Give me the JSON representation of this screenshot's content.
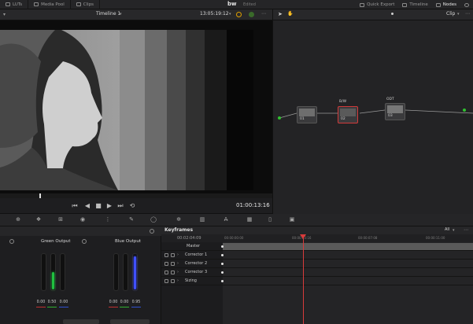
{
  "topbar": {
    "items": [
      {
        "label": "LUTs",
        "icon": "luts-icon"
      },
      {
        "label": "Media Pool",
        "icon": "media-pool-icon"
      },
      {
        "label": "Clips",
        "icon": "clips-icon"
      }
    ],
    "project_name": "bw",
    "project_status": "Edited",
    "right_items": [
      {
        "label": "Quick Export",
        "icon": "quick-export-icon"
      },
      {
        "label": "Timeline",
        "icon": "timeline-icon"
      },
      {
        "label": "Nodes",
        "icon": "nodes-icon",
        "active": true
      }
    ]
  },
  "viewer": {
    "timeline_name": "Timeline 1",
    "source_timecode": "13:05:19:12",
    "record_timecode": "01:00:13:16"
  },
  "nodes_panel": {
    "mode": "Clip",
    "nodes": [
      {
        "label": "",
        "number": "01"
      },
      {
        "label": "B/W",
        "number": "02"
      },
      {
        "label": "ODT",
        "number": "03"
      }
    ]
  },
  "outputs": {
    "green": {
      "title": "Green Output",
      "values": [
        "0.00",
        "0.50",
        "0.00"
      ],
      "level": 0.5
    },
    "blue": {
      "title": "Blue Output",
      "values": [
        "0.00",
        "0.00",
        "0.95"
      ],
      "level": 0.95
    }
  },
  "keyframes": {
    "title": "Keyframes",
    "filter": "All",
    "timecode": "00:02:04:09",
    "ruler": [
      "00:00:00:00",
      "00:00:03:16",
      "00:00:07:08",
      "00:00:11:00"
    ],
    "rows": [
      {
        "label": "Master"
      },
      {
        "label": "Corrector 1"
      },
      {
        "label": "Corrector 2"
      },
      {
        "label": "Corrector 3"
      },
      {
        "label": "Sizing"
      }
    ]
  },
  "colors": {
    "accent_red": "#d83b3b",
    "green": "#20c040",
    "blue": "#4050ff"
  }
}
